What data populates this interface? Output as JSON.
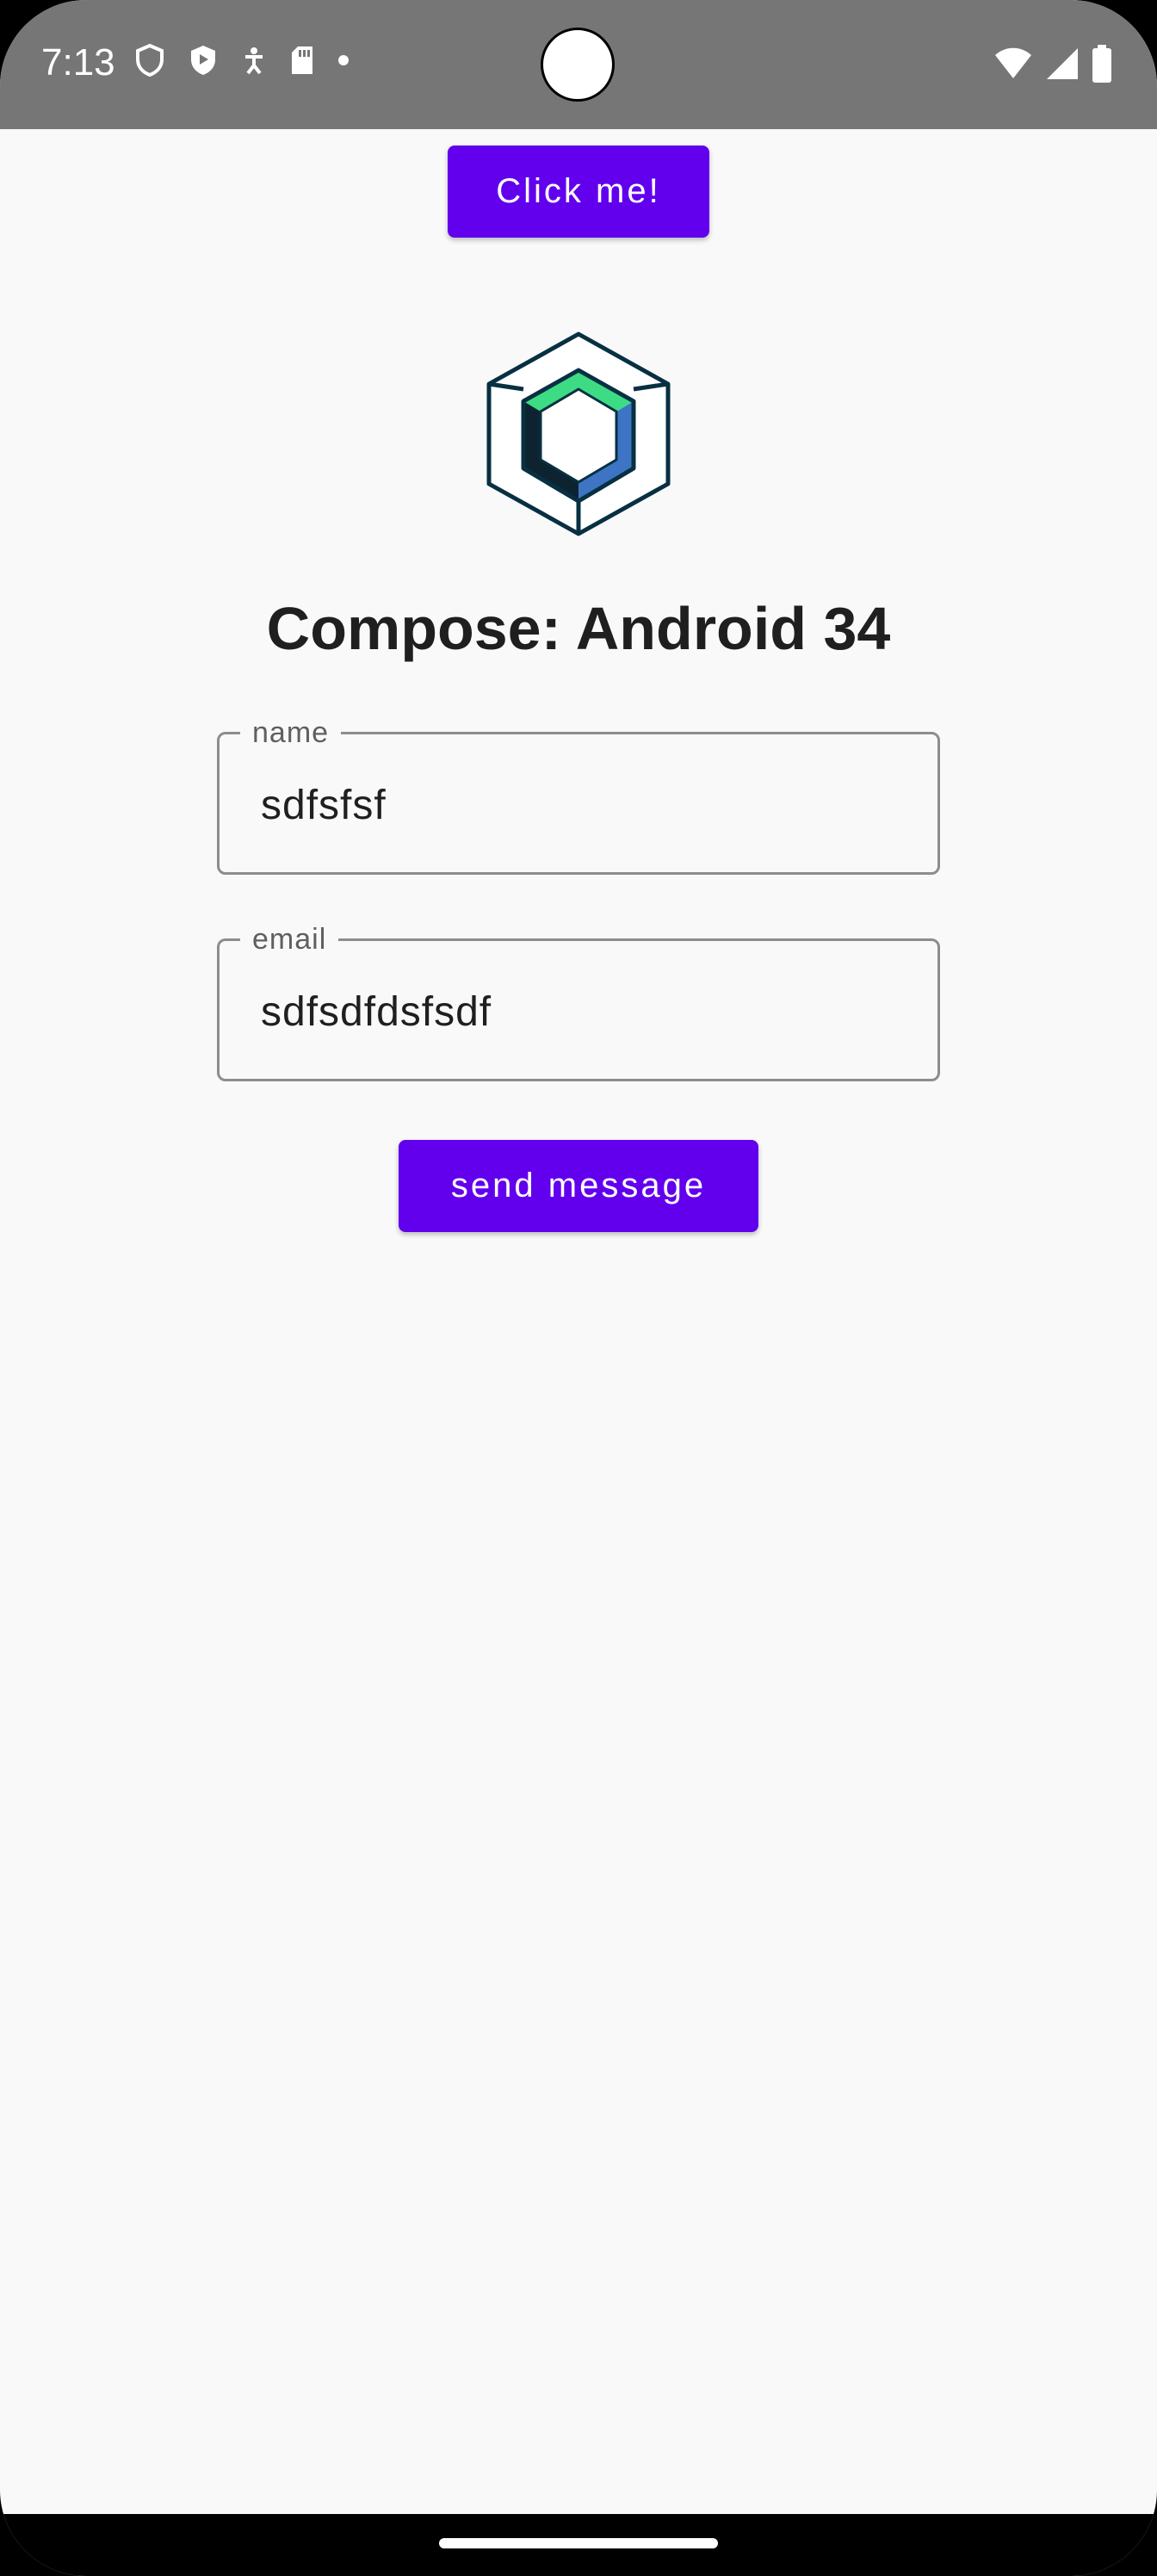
{
  "status_bar": {
    "time": "7:13",
    "left_icons": [
      "shield-outline-icon",
      "play-shield-icon",
      "accessibility-icon",
      "sd-card-icon",
      "dot-icon"
    ],
    "right_icons": [
      "wifi-icon",
      "cellular-signal-icon",
      "battery-icon"
    ]
  },
  "top_button": {
    "label": "Click me!"
  },
  "logo": {
    "icon": "jetpack-compose-logo-icon"
  },
  "page_title": "Compose: Android 34",
  "form": {
    "name": {
      "label": "name",
      "value": "sdfsfsf"
    },
    "email": {
      "label": "email",
      "value": "sdfsdfdsfsdf"
    }
  },
  "send_button": {
    "label": "send message"
  },
  "colors": {
    "primary": "#6200ee",
    "background": "#f9f9fa",
    "status_bar": "#767676",
    "logo_green": "#3ddc84",
    "logo_blue": "#4285f4",
    "logo_dark": "#073042"
  }
}
